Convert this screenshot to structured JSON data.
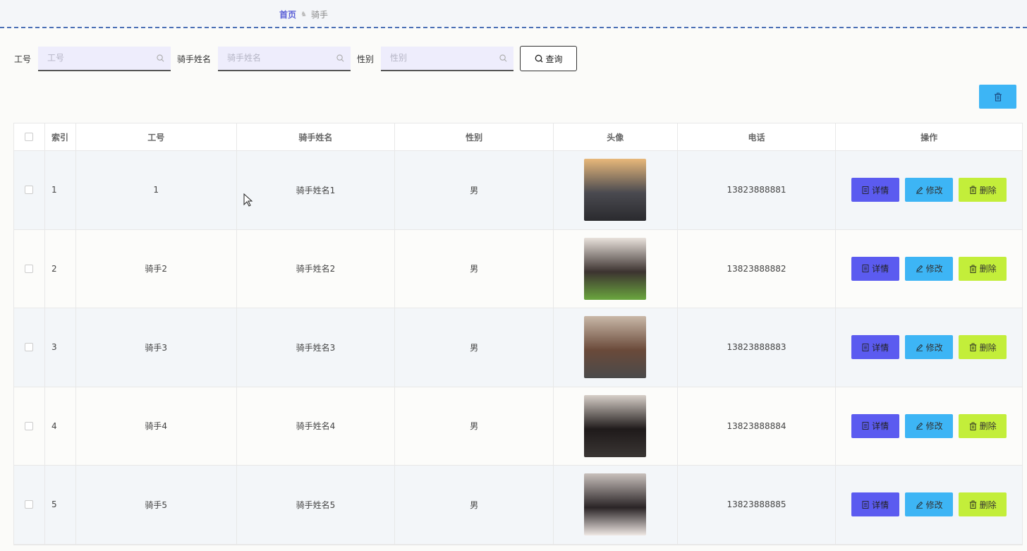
{
  "breadcrumb": {
    "home": "首页",
    "separator": "♞",
    "current": "骑手"
  },
  "search": {
    "fields": [
      {
        "label": "工号",
        "placeholder": "工号"
      },
      {
        "label": "骑手姓名",
        "placeholder": "骑手姓名"
      },
      {
        "label": "性别",
        "placeholder": "性别"
      }
    ],
    "query_label": "查询"
  },
  "toolbar": {
    "batch_delete_icon": "trash-icon"
  },
  "table": {
    "columns": [
      "索引",
      "工号",
      "骑手姓名",
      "性别",
      "头像",
      "电话",
      "操作"
    ],
    "rows": [
      {
        "index": "1",
        "no": "1",
        "name": "骑手姓名1",
        "gender": "男",
        "phone": "13823888881"
      },
      {
        "index": "2",
        "no": "骑手2",
        "name": "骑手姓名2",
        "gender": "男",
        "phone": "13823888882"
      },
      {
        "index": "3",
        "no": "骑手3",
        "name": "骑手姓名3",
        "gender": "男",
        "phone": "13823888883"
      },
      {
        "index": "4",
        "no": "骑手4",
        "name": "骑手姓名4",
        "gender": "男",
        "phone": "13823888884"
      },
      {
        "index": "5",
        "no": "骑手5",
        "name": "骑手姓名5",
        "gender": "男",
        "phone": "13823888885"
      }
    ],
    "actions": {
      "detail": "详情",
      "edit": "修改",
      "delete": "删除"
    }
  },
  "colors": {
    "detail": "#5b5bf0",
    "edit": "#3db5f5",
    "delete": "#c3ee3a",
    "accent": "#5a5fd6"
  }
}
